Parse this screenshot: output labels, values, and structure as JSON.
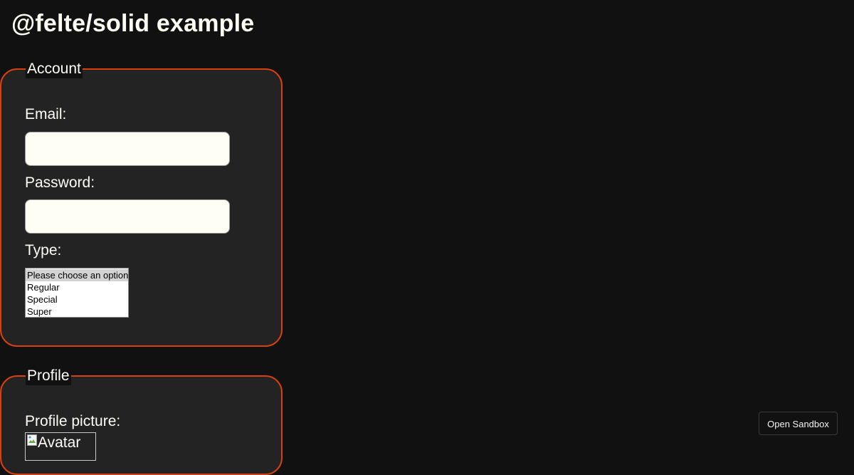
{
  "page": {
    "title": "@felte/solid example"
  },
  "account": {
    "legend": "Account",
    "email_label": "Email:",
    "email_value": "",
    "password_label": "Password:",
    "password_value": "",
    "type_label": "Type:",
    "type_options": [
      "Please choose an option",
      "Regular",
      "Special",
      "Super"
    ],
    "type_selected": "Please choose an option"
  },
  "profile": {
    "legend": "Profile",
    "picture_label": "Profile picture:",
    "avatar_alt": "Avatar"
  },
  "sandbox": {
    "label": "Open Sandbox"
  },
  "colors": {
    "accent": "#d8400e",
    "background": "#111111",
    "panel": "#232323",
    "text": "#fffef4"
  }
}
